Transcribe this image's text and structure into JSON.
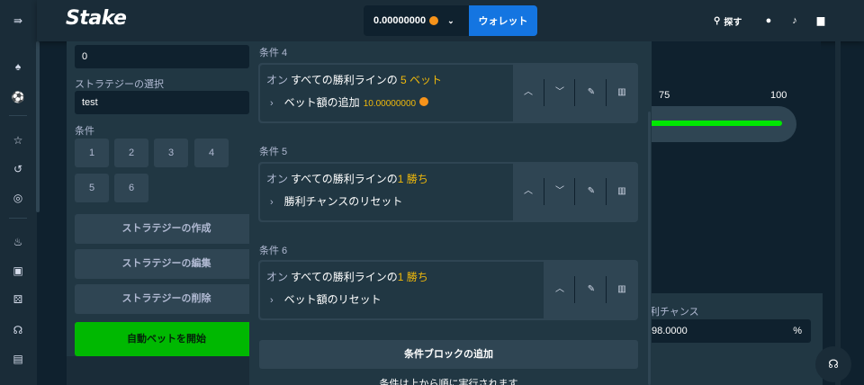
{
  "topbar": {
    "logo": "Stake",
    "balance": "0.00000000",
    "wallet_label": "ウォレット",
    "search_label": "探す"
  },
  "strategy_panel": {
    "top_field_value": "0",
    "strategy_select_label": "ストラテジーの選択",
    "strategy_select_value": "test",
    "conditions_label": "条件",
    "condition_numbers": [
      "1",
      "2",
      "3",
      "4",
      "5",
      "6"
    ],
    "create_label": "ストラテジーの作成",
    "edit_label": "ストラテジーの編集",
    "delete_label": "ストラテジーの削除",
    "start_label": "自動ベットを開始"
  },
  "right_panel": {
    "tick_75": "75",
    "tick_100": "100",
    "win_chance_label": "利チャンス",
    "win_chance_value": "98.0000",
    "percent_symbol": "%"
  },
  "conditions": [
    {
      "title": "条件 4",
      "on": "オン",
      "trigger_prefix": "すべての勝利ラインの",
      "trigger_value": "5 ベット",
      "action": "ベット額の追加",
      "amount": "10.00000000"
    },
    {
      "title": "条件 5",
      "on": "オン",
      "trigger_prefix": "すべての勝利ラインの",
      "trigger_value": "1 勝ち",
      "action": "勝利チャンスのリセット"
    },
    {
      "title": "条件 6",
      "on": "オン",
      "trigger_prefix": "すべての勝利ラインの",
      "trigger_value": "1 勝ち",
      "action": "ベット額のリセット"
    }
  ],
  "modal": {
    "add_block_label": "条件ブロックの追加",
    "note": "条件は上から順に実行されます"
  },
  "colors": {
    "accent": "#1475e1",
    "highlight": "#f0b90b",
    "start_green": "#00b801",
    "panel": "#213743"
  }
}
